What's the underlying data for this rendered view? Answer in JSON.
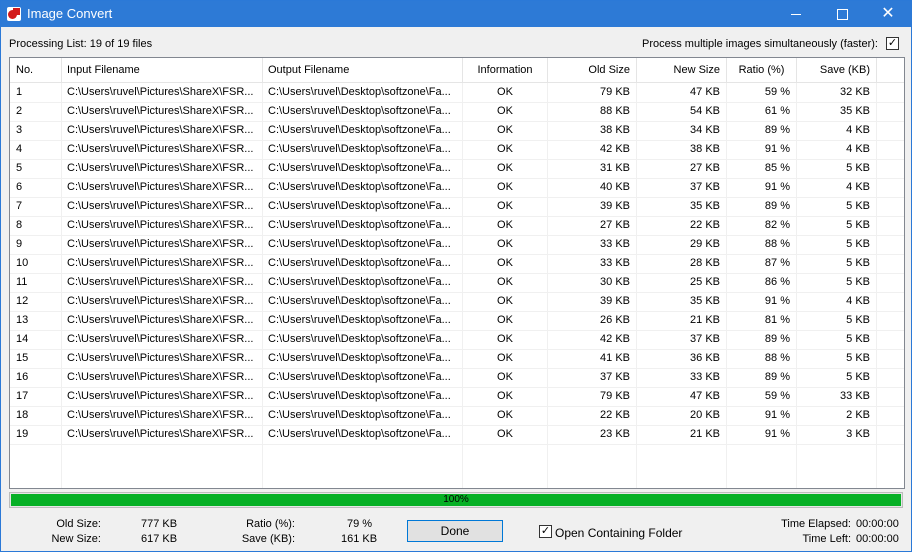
{
  "window": {
    "title": "Image Convert",
    "minimize": "minimize",
    "maximize": "maximize",
    "close": "✕"
  },
  "processing_label": "Processing List: 19 of 19 files",
  "multi_option": {
    "label": "Process multiple images simultaneously (faster):",
    "checked": true
  },
  "columns": [
    "No.",
    "Input Filename",
    "Output Filename",
    "Information",
    "Old Size",
    "New Size",
    "Ratio (%)",
    "Save (KB)"
  ],
  "rows": [
    [
      "1",
      "C:\\Users\\ruvel\\Pictures\\ShareX\\FSR...",
      "C:\\Users\\ruvel\\Desktop\\softzone\\Fa...",
      "OK",
      "79 KB",
      "47 KB",
      "59 %",
      "32 KB"
    ],
    [
      "2",
      "C:\\Users\\ruvel\\Pictures\\ShareX\\FSR...",
      "C:\\Users\\ruvel\\Desktop\\softzone\\Fa...",
      "OK",
      "88 KB",
      "54 KB",
      "61 %",
      "35 KB"
    ],
    [
      "3",
      "C:\\Users\\ruvel\\Pictures\\ShareX\\FSR...",
      "C:\\Users\\ruvel\\Desktop\\softzone\\Fa...",
      "OK",
      "38 KB",
      "34 KB",
      "89 %",
      "4 KB"
    ],
    [
      "4",
      "C:\\Users\\ruvel\\Pictures\\ShareX\\FSR...",
      "C:\\Users\\ruvel\\Desktop\\softzone\\Fa...",
      "OK",
      "42 KB",
      "38 KB",
      "91 %",
      "4 KB"
    ],
    [
      "5",
      "C:\\Users\\ruvel\\Pictures\\ShareX\\FSR...",
      "C:\\Users\\ruvel\\Desktop\\softzone\\Fa...",
      "OK",
      "31 KB",
      "27 KB",
      "85 %",
      "5 KB"
    ],
    [
      "6",
      "C:\\Users\\ruvel\\Pictures\\ShareX\\FSR...",
      "C:\\Users\\ruvel\\Desktop\\softzone\\Fa...",
      "OK",
      "40 KB",
      "37 KB",
      "91 %",
      "4 KB"
    ],
    [
      "7",
      "C:\\Users\\ruvel\\Pictures\\ShareX\\FSR...",
      "C:\\Users\\ruvel\\Desktop\\softzone\\Fa...",
      "OK",
      "39 KB",
      "35 KB",
      "89 %",
      "5 KB"
    ],
    [
      "8",
      "C:\\Users\\ruvel\\Pictures\\ShareX\\FSR...",
      "C:\\Users\\ruvel\\Desktop\\softzone\\Fa...",
      "OK",
      "27 KB",
      "22 KB",
      "82 %",
      "5 KB"
    ],
    [
      "9",
      "C:\\Users\\ruvel\\Pictures\\ShareX\\FSR...",
      "C:\\Users\\ruvel\\Desktop\\softzone\\Fa...",
      "OK",
      "33 KB",
      "29 KB",
      "88 %",
      "5 KB"
    ],
    [
      "10",
      "C:\\Users\\ruvel\\Pictures\\ShareX\\FSR...",
      "C:\\Users\\ruvel\\Desktop\\softzone\\Fa...",
      "OK",
      "33 KB",
      "28 KB",
      "87 %",
      "5 KB"
    ],
    [
      "11",
      "C:\\Users\\ruvel\\Pictures\\ShareX\\FSR...",
      "C:\\Users\\ruvel\\Desktop\\softzone\\Fa...",
      "OK",
      "30 KB",
      "25 KB",
      "86 %",
      "5 KB"
    ],
    [
      "12",
      "C:\\Users\\ruvel\\Pictures\\ShareX\\FSR...",
      "C:\\Users\\ruvel\\Desktop\\softzone\\Fa...",
      "OK",
      "39 KB",
      "35 KB",
      "91 %",
      "4 KB"
    ],
    [
      "13",
      "C:\\Users\\ruvel\\Pictures\\ShareX\\FSR...",
      "C:\\Users\\ruvel\\Desktop\\softzone\\Fa...",
      "OK",
      "26 KB",
      "21 KB",
      "81 %",
      "5 KB"
    ],
    [
      "14",
      "C:\\Users\\ruvel\\Pictures\\ShareX\\FSR...",
      "C:\\Users\\ruvel\\Desktop\\softzone\\Fa...",
      "OK",
      "42 KB",
      "37 KB",
      "89 %",
      "5 KB"
    ],
    [
      "15",
      "C:\\Users\\ruvel\\Pictures\\ShareX\\FSR...",
      "C:\\Users\\ruvel\\Desktop\\softzone\\Fa...",
      "OK",
      "41 KB",
      "36 KB",
      "88 %",
      "5 KB"
    ],
    [
      "16",
      "C:\\Users\\ruvel\\Pictures\\ShareX\\FSR...",
      "C:\\Users\\ruvel\\Desktop\\softzone\\Fa...",
      "OK",
      "37 KB",
      "33 KB",
      "89 %",
      "5 KB"
    ],
    [
      "17",
      "C:\\Users\\ruvel\\Pictures\\ShareX\\FSR...",
      "C:\\Users\\ruvel\\Desktop\\softzone\\Fa...",
      "OK",
      "79 KB",
      "47 KB",
      "59 %",
      "33 KB"
    ],
    [
      "18",
      "C:\\Users\\ruvel\\Pictures\\ShareX\\FSR...",
      "C:\\Users\\ruvel\\Desktop\\softzone\\Fa...",
      "OK",
      "22 KB",
      "20 KB",
      "91 %",
      "2 KB"
    ],
    [
      "19",
      "C:\\Users\\ruvel\\Pictures\\ShareX\\FSR...",
      "C:\\Users\\ruvel\\Desktop\\softzone\\Fa...",
      "OK",
      "23 KB",
      "21 KB",
      "91 %",
      "3 KB"
    ]
  ],
  "progress": {
    "fraction": 1.0,
    "label": "100%",
    "color": "#06b025"
  },
  "stats": {
    "old_size_label": "Old Size:",
    "old_size": "777 KB",
    "new_size_label": "New Size:",
    "new_size": "617 KB",
    "ratio_label": "Ratio (%):",
    "ratio": "79 %",
    "save_label": "Save (KB):",
    "save": "161 KB",
    "elapsed_label": "Time Elapsed:",
    "elapsed": "00:00:00",
    "left_label": "Time Left:",
    "left": "00:00:00"
  },
  "done_button": "Done",
  "open_folder": {
    "label": "Open Containing Folder",
    "checked": true
  },
  "colors": {
    "titlebar": "#2d7ad6",
    "progress": "#06b025",
    "accent": "#0078d7"
  }
}
